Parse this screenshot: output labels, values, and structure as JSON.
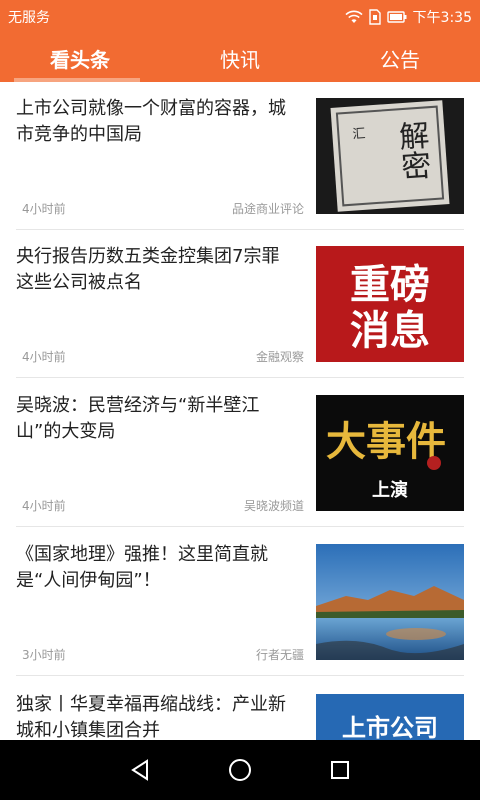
{
  "status_bar": {
    "carrier": "无服务",
    "time": "下午3:35",
    "icons": [
      "wifi-icon",
      "sim-icon",
      "battery-icon"
    ]
  },
  "tabs": [
    {
      "label": "看头条",
      "active": true
    },
    {
      "label": "快讯",
      "active": false
    },
    {
      "label": "公告",
      "active": false
    }
  ],
  "news": [
    {
      "title": "上市公司就像一个财富的容器，城市竞争的中国局",
      "time": "4小时前",
      "source": "品途商业评论",
      "thumb_text": "解密",
      "thumb_small": "汇"
    },
    {
      "title": "央行报告历数五类金控集团7宗罪 这些公司被点名",
      "time": "4小时前",
      "source": "金融观察",
      "thumb_line1": "重磅",
      "thumb_line2": "消息"
    },
    {
      "title": "吴晓波：民营经济与“新半壁江山”的大变局",
      "time": "4小时前",
      "source": "吴晓波频道",
      "thumb_text": "大事件",
      "thumb_sub": "上演"
    },
    {
      "title": "《国家地理》强推！这里简直就是“人间伊甸园”！",
      "time": "3小时前",
      "source": "行者无疆"
    },
    {
      "title": "独家丨华夏幸福再缩战线：产业新城和小镇集团合并",
      "time": "",
      "source": "",
      "thumb_text": "上市公司"
    }
  ],
  "colors": {
    "accent": "#f26b32",
    "tab_indicator": "#f7a47f",
    "nav_bar": "#000000"
  },
  "nav": [
    "back-icon",
    "home-icon",
    "recents-icon"
  ]
}
